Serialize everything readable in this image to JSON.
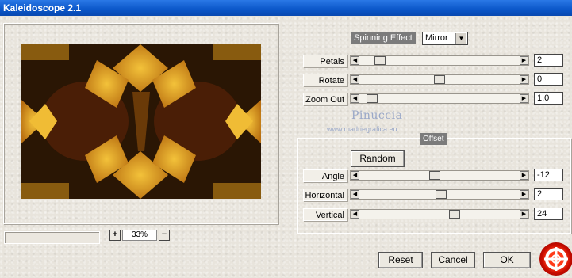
{
  "window": {
    "title": "Kaleidoscope 2.1"
  },
  "spinning_effect": {
    "label": "Spinning Effect",
    "selected": "Mirror"
  },
  "sliders": [
    {
      "key": "petals",
      "label": "Petals",
      "value": "2",
      "level": 0.1
    },
    {
      "key": "rotate",
      "label": "Rotate",
      "value": "0",
      "level": 0.5
    },
    {
      "key": "zoom_out",
      "label": "Zoom Out",
      "value": "1.0",
      "level": 0.05
    }
  ],
  "offset": {
    "label": "Offset",
    "random_label": "Random",
    "sliders": [
      {
        "key": "angle",
        "label": "Angle",
        "value": "-12",
        "level": 0.47
      },
      {
        "key": "horizontal",
        "label": "Horizontal",
        "value": "2",
        "level": 0.51
      },
      {
        "key": "vertical",
        "label": "Vertical",
        "value": "24",
        "level": 0.6
      }
    ]
  },
  "zoom": {
    "plus": "+",
    "value": "33%",
    "minus": "−"
  },
  "watermark": {
    "name": "Pinuccia",
    "site": "www.madriegrafica.eu"
  },
  "buttons": {
    "reset": "Reset",
    "cancel": "Cancel",
    "ok": "OK"
  },
  "icons": {
    "help": "lifebuoy-icon",
    "arrow_left": "arrow-left-icon",
    "arrow_right": "arrow-right-icon",
    "dropdown": "chevron-down-icon"
  },
  "colors": {
    "title_bar": "#0a56c8",
    "preview_dark": "#2a1604",
    "preview_gold": "#e0a020"
  }
}
